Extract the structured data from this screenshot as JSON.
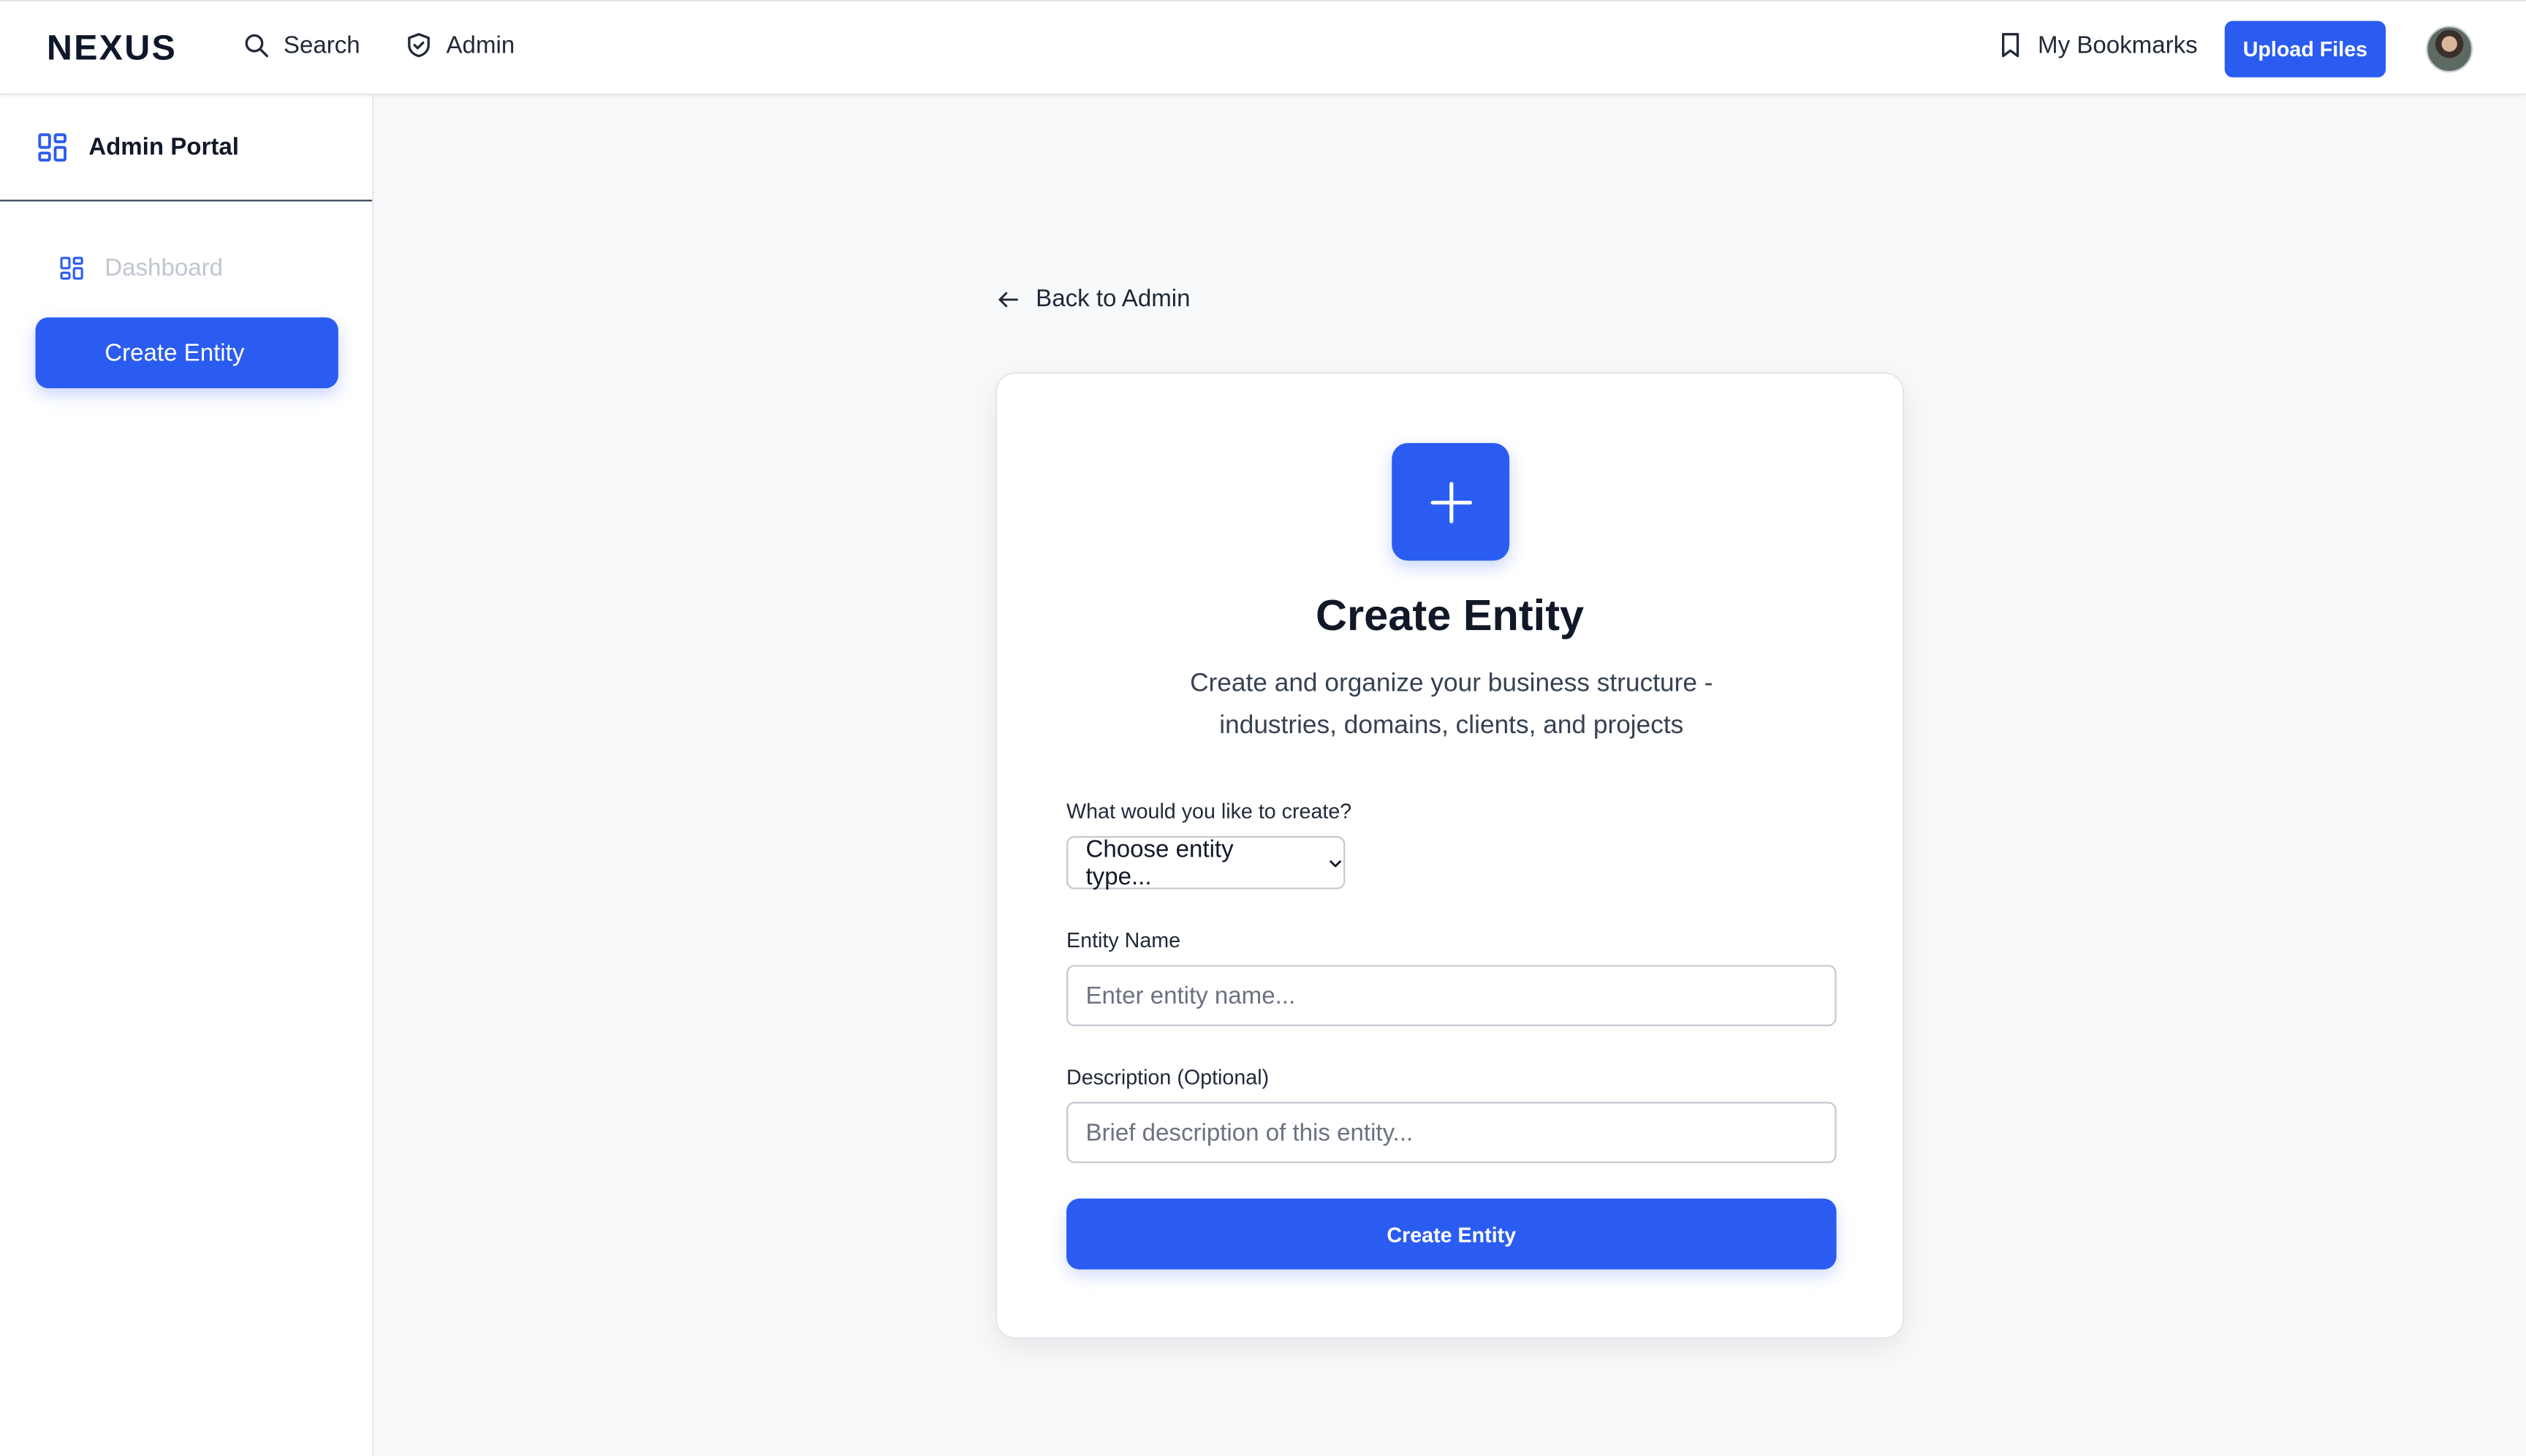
{
  "header": {
    "brand": "NEXUS",
    "nav": [
      {
        "label": "Search",
        "icon": "search-icon"
      },
      {
        "label": "Admin",
        "icon": "shield-icon"
      }
    ],
    "bookmarks_label": "My Bookmarks",
    "upload_label": "Upload Files"
  },
  "sidebar": {
    "title": "Admin Portal",
    "items": [
      {
        "label": "Dashboard",
        "icon": "dashboard-icon",
        "active": false
      },
      {
        "label": "Create Entity",
        "active": true
      }
    ]
  },
  "main": {
    "back_label": "Back to Admin",
    "card": {
      "title": "Create Entity",
      "subtitle": "Create and organize your business structure - industries, domains, clients, and projects",
      "type_label": "What would you like to create?",
      "type_selected": "Choose entity type...",
      "name_label": "Entity Name",
      "name_placeholder": "Enter entity name...",
      "desc_label": "Description (Optional)",
      "desc_placeholder": "Brief description of this entity...",
      "submit_label": "Create Entity"
    }
  },
  "colors": {
    "accent": "#2b5cf2",
    "background": "#f8f9fb",
    "text": "#111827",
    "muted": "#c0c6d0"
  }
}
